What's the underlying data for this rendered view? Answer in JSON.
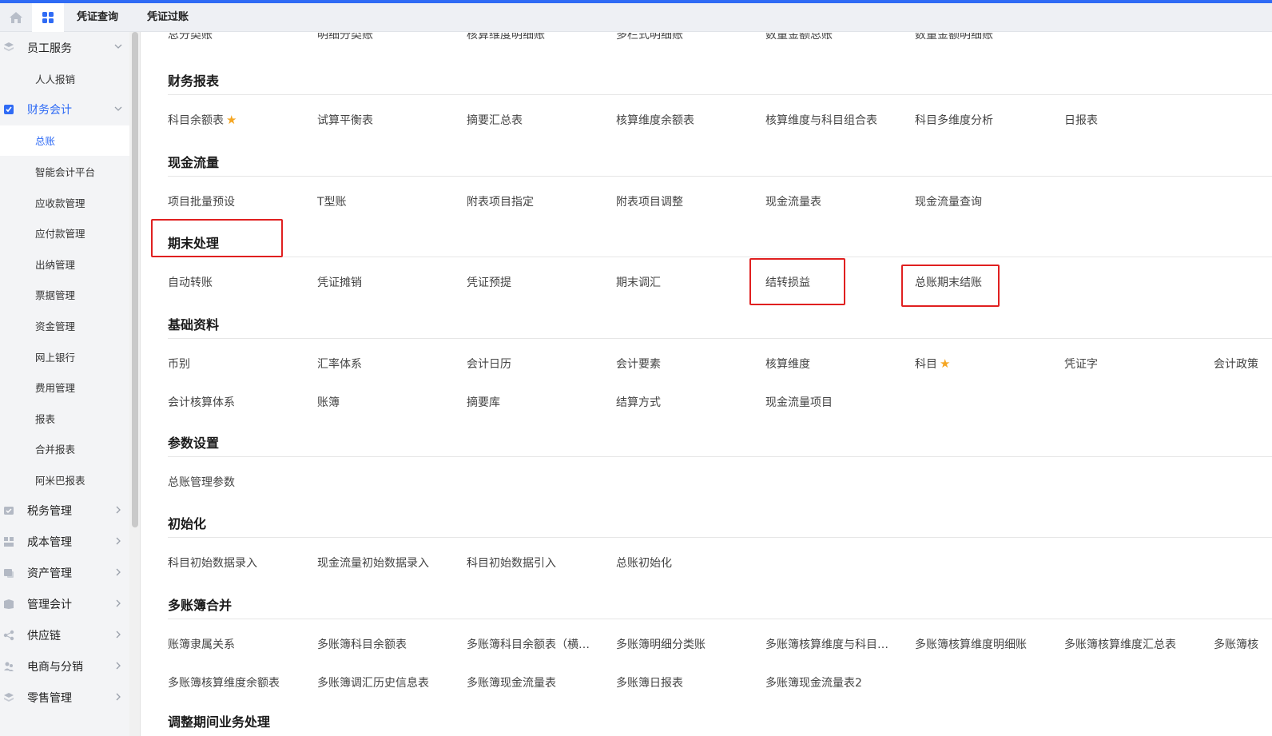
{
  "tabs": [
    {
      "label": "凭证查询"
    },
    {
      "label": "凭证过账"
    }
  ],
  "sidebar": {
    "groups": [
      {
        "label": "员工服务",
        "subs": [
          "人人报销"
        ]
      },
      {
        "label": "财务会计",
        "active": true,
        "subs": [
          "总账",
          "智能会计平台",
          "应收款管理",
          "应付款管理",
          "出纳管理",
          "票据管理",
          "资金管理",
          "网上银行",
          "费用管理",
          "报表",
          "合并报表",
          "阿米巴报表"
        ],
        "active_sub": "总账"
      },
      {
        "label": "税务管理"
      },
      {
        "label": "成本管理"
      },
      {
        "label": "资产管理"
      },
      {
        "label": "管理会计"
      },
      {
        "label": "供应链"
      },
      {
        "label": "电商与分销"
      },
      {
        "label": "零售管理"
      }
    ]
  },
  "top_cut_row": [
    "总分类账",
    "明细分类账",
    "核算维度明细账",
    "多栏式明细账",
    "数量金额总账",
    "数量金额明细账"
  ],
  "sections": [
    {
      "title": "财务报表",
      "rows": [
        [
          {
            "t": "科目余额表",
            "star": true
          },
          {
            "t": "试算平衡表"
          },
          {
            "t": "摘要汇总表"
          },
          {
            "t": "核算维度余额表"
          },
          {
            "t": "核算维度与科目组合表"
          },
          {
            "t": "科目多维度分析"
          },
          {
            "t": "日报表"
          }
        ]
      ]
    },
    {
      "title": "现金流量",
      "rows": [
        [
          {
            "t": "项目批量预设"
          },
          {
            "t": "T型账"
          },
          {
            "t": "附表项目指定"
          },
          {
            "t": "附表项目调整"
          },
          {
            "t": "现金流量表"
          },
          {
            "t": "现金流量查询"
          }
        ]
      ]
    },
    {
      "title": "期末处理",
      "rows": [
        [
          {
            "t": "自动转账"
          },
          {
            "t": "凭证摊销"
          },
          {
            "t": "凭证预提"
          },
          {
            "t": "期末调汇"
          },
          {
            "t": "结转损益"
          },
          {
            "t": "总账期末结账"
          }
        ]
      ]
    },
    {
      "title": "基础资料",
      "rows": [
        [
          {
            "t": "币别"
          },
          {
            "t": "汇率体系"
          },
          {
            "t": "会计日历"
          },
          {
            "t": "会计要素"
          },
          {
            "t": "核算维度"
          },
          {
            "t": "科目",
            "star": true
          },
          {
            "t": "凭证字"
          },
          {
            "t": "会计政策"
          }
        ],
        [
          {
            "t": "会计核算体系"
          },
          {
            "t": "账簿"
          },
          {
            "t": "摘要库"
          },
          {
            "t": "结算方式"
          },
          {
            "t": "现金流量项目"
          }
        ]
      ]
    },
    {
      "title": "参数设置",
      "rows": [
        [
          {
            "t": "总账管理参数"
          }
        ]
      ]
    },
    {
      "title": "初始化",
      "rows": [
        [
          {
            "t": "科目初始数据录入"
          },
          {
            "t": "现金流量初始数据录入"
          },
          {
            "t": "科目初始数据引入"
          },
          {
            "t": "总账初始化"
          }
        ]
      ]
    },
    {
      "title": "多账簿合并",
      "rows": [
        [
          {
            "t": "账簿隶属关系"
          },
          {
            "t": "多账簿科目余额表"
          },
          {
            "t": "多账簿科目余额表（横…"
          },
          {
            "t": "多账簿明细分类账"
          },
          {
            "t": "多账簿核算维度与科目…"
          },
          {
            "t": "多账簿核算维度明细账"
          },
          {
            "t": "多账簿核算维度汇总表"
          },
          {
            "t": "多账簿核"
          }
        ],
        [
          {
            "t": "多账簿核算维度余额表"
          },
          {
            "t": "多账簿调汇历史信息表"
          },
          {
            "t": "多账簿现金流量表"
          },
          {
            "t": "多账簿日报表"
          },
          {
            "t": "多账簿现金流量表2"
          }
        ]
      ]
    },
    {
      "title": "调整期间业务处理",
      "rows": []
    }
  ],
  "colors": {
    "accent": "#2f6bf5",
    "highlight": "#e02020",
    "star": "#f5a623"
  }
}
